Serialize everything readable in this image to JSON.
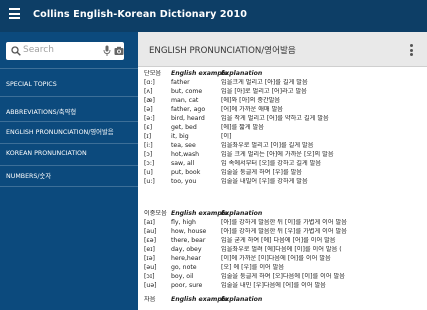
{
  "appbar": {
    "title": "Collins English-Korean Dictionary 2010"
  },
  "search": {
    "placeholder": "Search"
  },
  "sidebar": {
    "section_title": "SPECIAL TOPICS",
    "items": [
      {
        "label": "ABBREVIATIONS/축약형"
      },
      {
        "label": "ENGLISH PRONUNCIATION/영어발음"
      },
      {
        "label": "KOREAN PRONUNCIATION"
      },
      {
        "label": "NUMBERS/숫자"
      }
    ]
  },
  "content": {
    "title": "ENGLISH PRONUNCIATION/영어발음",
    "sections": [
      {
        "header": {
          "col1": "단모음",
          "col2": "English example",
          "col3": "Explanation"
        },
        "rows": [
          {
            "symbol": "[ɑ:]",
            "example": "father",
            "explanation": "입을크게 벌리고 [아]를 길게 발음"
          },
          {
            "symbol": "[ʌ]",
            "example": "but, come",
            "explanation": "입을 [아]로 벌리고 [어]라고 발음"
          },
          {
            "symbol": "[æ]",
            "example": "man, cat",
            "explanation": "[에]와 [아]의 중간발음"
          },
          {
            "symbol": "[ə]",
            "example": "father, ago",
            "explanation": "[어]에 가까운 애매 발음"
          },
          {
            "symbol": "[ə:]",
            "example": "bird, heard",
            "explanation": "입을 작게 벌리고 [어]를 약하고 길게 발음"
          },
          {
            "symbol": "[ɛ]",
            "example": "get, bed",
            "explanation": "[에]를 짧게 발음"
          },
          {
            "symbol": "[ɪ]",
            "example": "it, big",
            "explanation": "[이]"
          },
          {
            "symbol": "[i:]",
            "example": "tea, see",
            "explanation": "입을좌우로 벌리고 [이]를 길게 발음"
          },
          {
            "symbol": "[ɔ]",
            "example": "hot,wash",
            "explanation": "입을 크게 벌리는 [아]에 가까운 [오]의 발음"
          },
          {
            "symbol": "[ɔ:]",
            "example": "saw, all",
            "explanation": "입 속에서부터 [오]를 강하고 길게 발음"
          },
          {
            "symbol": "[u]",
            "example": "put, book",
            "explanation": "입술을 둥글게 하여 [우]를 발음"
          },
          {
            "symbol": "[u:]",
            "example": "too, you",
            "explanation": "입술을 내밀어 [우]를 강하게 발음"
          }
        ]
      },
      {
        "header": {
          "col1": "이중모음",
          "col2": "English example",
          "col3": "Explanation"
        },
        "rows": [
          {
            "symbol": "[aɪ]",
            "example": "fly, high",
            "explanation": "[아]를 강하게 발음한 뒤 [이]를 가볍게 이어 발음"
          },
          {
            "symbol": "[au]",
            "example": "how, house",
            "explanation": "[아]를 강하게 발음한 뒤 [우]를 가볍게 이어 발음"
          },
          {
            "symbol": "[ɛə]",
            "example": "there, bear",
            "explanation": "입을 굳게 하여 [에] 다음에 [어]를 이어 발음"
          },
          {
            "symbol": "[eɪ]",
            "example": "day, obey",
            "explanation": "입을좌우로 벌려 [에]다음에 [이]를 이어 발음 ("
          },
          {
            "symbol": "[ɪə]",
            "example": "here,hear",
            "explanation": "[이]에 가까운 [이]다음에 [어]를 이어 발음"
          },
          {
            "symbol": "[əu]",
            "example": "go, note",
            "explanation": "[오] 에 [우]를 이어 발음"
          },
          {
            "symbol": "[ɔɪ]",
            "example": "boy, oil",
            "explanation": "입술을 둥글게 하여 [오]다음에 [이]를 이어 발음"
          },
          {
            "symbol": "[uə]",
            "example": "poor, sure",
            "explanation": "입술을 내민 [우]다음에 [어]를 이어 발음"
          }
        ]
      },
      {
        "header": {
          "col1": "자음",
          "col2": "English example",
          "col3": "Explanation"
        },
        "rows": []
      }
    ]
  }
}
